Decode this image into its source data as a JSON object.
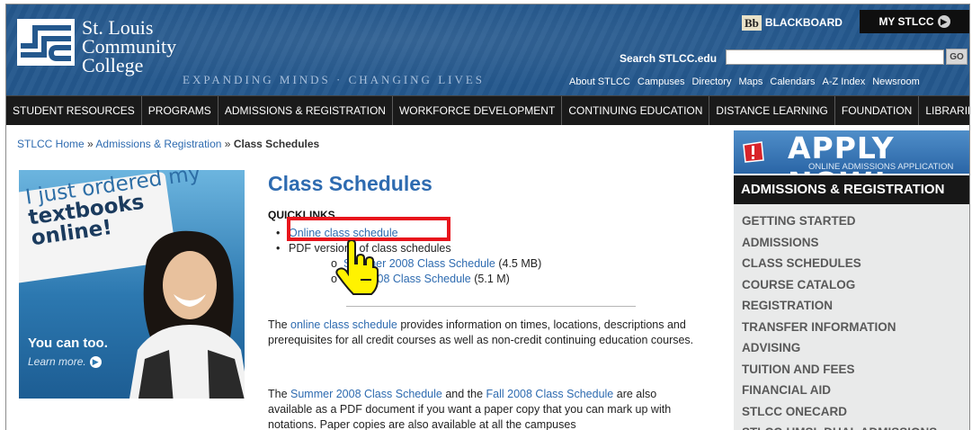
{
  "header": {
    "logo_line1": "St. Louis",
    "logo_line2": "Community",
    "logo_line3": "College",
    "tagline": "EXPANDING MINDS · CHANGING LIVES",
    "blackboard_logo": "Bb",
    "blackboard_label": "BLACKBOARD",
    "my_stlcc_label": "MY STLCC",
    "search_label": "Search STLCC.edu",
    "search_value": "",
    "go_label": "GO",
    "top_links": [
      "About STLCC",
      "Campuses",
      "Directory",
      "Maps",
      "Calendars",
      "A-Z Index",
      "Newsroom"
    ]
  },
  "nav": {
    "items": [
      "STUDENT RESOURCES",
      "PROGRAMS",
      "ADMISSIONS & REGISTRATION",
      "WORKFORCE DEVELOPMENT",
      "CONTINUING EDUCATION",
      "DISTANCE LEARNING",
      "FOUNDATION",
      "LIBRARIES"
    ]
  },
  "breadcrumb": {
    "home": "STLCC Home",
    "sep": "»",
    "section": "Admissions & Registration",
    "current": "Class Schedules"
  },
  "promo": {
    "line1": "I just ordered my",
    "line2": "textbooks",
    "line3": "online!",
    "cta": "You can too.",
    "learn_more": "Learn more."
  },
  "main": {
    "title": "Class Schedules",
    "quicklinks_label": "QUICKLINKS",
    "link_online": "Online class schedule",
    "pdf_label": "PDF versions of class schedules",
    "pdf_summer_link": "Summer 2008 Class Schedule",
    "pdf_summer_size": "(4.5 MB)",
    "pdf_fall_link": "Fall 2008 Class Schedule",
    "pdf_fall_size": "(5.1 M)",
    "para1_pre": "The ",
    "para1_link": "online class schedule",
    "para1_post": " provides information on times, locations, descriptions and prerequisites for all credit courses as well as non-credit continuing education courses.",
    "para2_pre": "The ",
    "para2_link1": "Summer 2008 Class Schedule",
    "para2_mid": " and the ",
    "para2_link2": "Fall 2008 Class Schedule",
    "para2_post": " are also available as a PDF document if you want a paper copy that you can mark up with notations. Paper copies are also available at all the campuses"
  },
  "sidebar": {
    "apply_now": "APPLY NOW!",
    "apply_sub": "ONLINE ADMISSIONS APPLICATION",
    "section_title": "ADMISSIONS & REGISTRATION",
    "items": [
      "GETTING STARTED",
      "ADMISSIONS",
      "CLASS SCHEDULES",
      "COURSE CATALOG",
      "REGISTRATION",
      "TRANSFER INFORMATION",
      "ADVISING",
      "TUITION AND FEES",
      "FINANCIAL AID",
      "STLCC ONECARD",
      "STLCC-UMSL DUAL ADMISSIONS"
    ]
  },
  "colors": {
    "header_blue": "#24588d",
    "link_blue": "#2e6bb0",
    "nav_black": "#1a1a1a",
    "highlight_red": "#e8141c",
    "cursor_yellow": "#fff200"
  }
}
